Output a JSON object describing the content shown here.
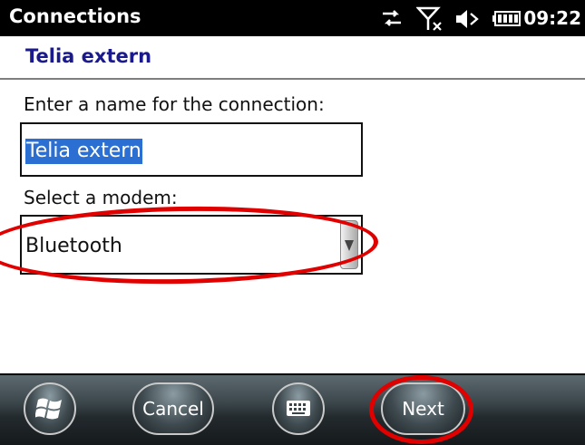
{
  "titlebar": {
    "title": "Connections",
    "time": "09:22",
    "icons": [
      "data-transfer-icon",
      "no-signal-icon",
      "volume-icon",
      "battery-icon"
    ]
  },
  "header": {
    "title": "Telia extern"
  },
  "form": {
    "name_label": "Enter a name for the connection:",
    "name_value": "Telia extern",
    "modem_label": "Select a modem:",
    "modem_value": "Bluetooth"
  },
  "softkeys": {
    "start_icon": "windows-start-icon",
    "cancel_label": "Cancel",
    "keyboard_icon": "keyboard-icon",
    "next_label": "Next"
  },
  "colors": {
    "accent": "#1a1a8c",
    "selection": "#2a6fd1",
    "highlight": "#e00000"
  }
}
